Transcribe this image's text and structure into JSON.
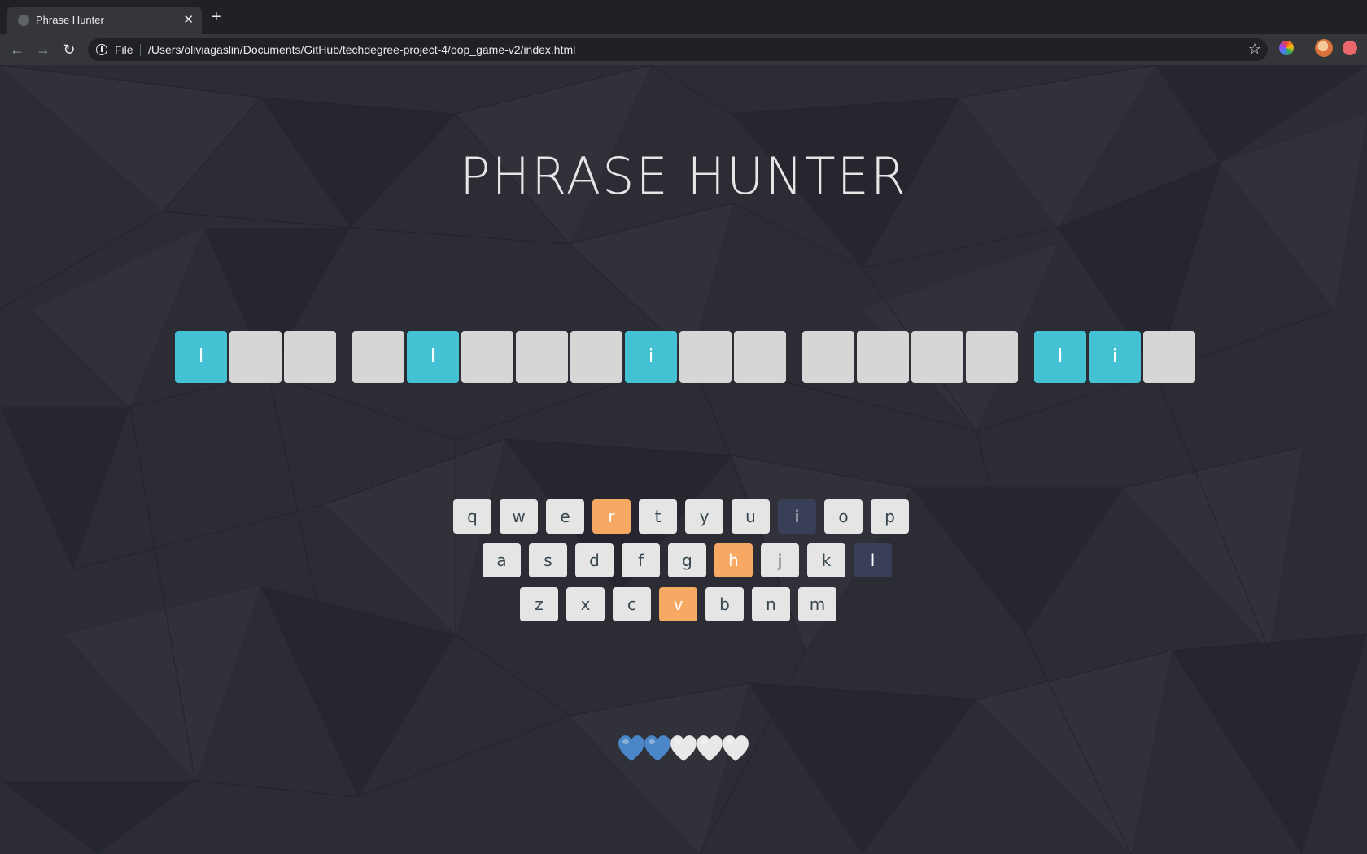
{
  "browser": {
    "tab_title": "Phrase Hunter",
    "tab_close": "✕",
    "new_tab": "+",
    "scheme": "File",
    "url": "/Users/oliviagaslin/Documents/GitHub/techdegree-project-4/oop_game-v2/index.html"
  },
  "game": {
    "title": "PHRASE HUNTER",
    "phrase": [
      {
        "letter": "l",
        "shown": true
      },
      {
        "letter": "",
        "shown": false
      },
      {
        "letter": "",
        "shown": false
      },
      {
        "letter": "",
        "shown": false
      },
      {
        "letter": "l",
        "shown": true
      },
      {
        "letter": "",
        "shown": false
      },
      {
        "letter": "",
        "shown": false
      },
      {
        "letter": "",
        "shown": false
      },
      {
        "letter": "i",
        "shown": true
      },
      {
        "letter": "",
        "shown": false
      },
      {
        "letter": "",
        "shown": false
      },
      {
        "letter": "",
        "shown": false
      },
      {
        "letter": "",
        "shown": false
      },
      {
        "letter": "",
        "shown": false
      },
      {
        "letter": "",
        "shown": false
      },
      {
        "letter": "l",
        "shown": true
      },
      {
        "letter": "i",
        "shown": true
      },
      {
        "letter": "",
        "shown": false
      }
    ],
    "keyboard": {
      "row1": [
        {
          "key": "q",
          "state": "default"
        },
        {
          "key": "w",
          "state": "default"
        },
        {
          "key": "e",
          "state": "default"
        },
        {
          "key": "r",
          "state": "wrong"
        },
        {
          "key": "t",
          "state": "default"
        },
        {
          "key": "y",
          "state": "default"
        },
        {
          "key": "u",
          "state": "default"
        },
        {
          "key": "i",
          "state": "chosen"
        },
        {
          "key": "o",
          "state": "default"
        },
        {
          "key": "p",
          "state": "default"
        }
      ],
      "row2": [
        {
          "key": "a",
          "state": "default"
        },
        {
          "key": "s",
          "state": "default"
        },
        {
          "key": "d",
          "state": "default"
        },
        {
          "key": "f",
          "state": "default"
        },
        {
          "key": "g",
          "state": "default"
        },
        {
          "key": "h",
          "state": "wrong"
        },
        {
          "key": "j",
          "state": "default"
        },
        {
          "key": "k",
          "state": "default"
        },
        {
          "key": "l",
          "state": "chosen"
        }
      ],
      "row3": [
        {
          "key": "z",
          "state": "default"
        },
        {
          "key": "x",
          "state": "default"
        },
        {
          "key": "c",
          "state": "default"
        },
        {
          "key": "v",
          "state": "wrong"
        },
        {
          "key": "b",
          "state": "default"
        },
        {
          "key": "n",
          "state": "default"
        },
        {
          "key": "m",
          "state": "default"
        }
      ]
    },
    "lives": {
      "total": 5,
      "remaining": 2
    },
    "colors": {
      "shown_letter": "#44c2d4",
      "hidden_letter": "#d6d6d6",
      "key_default": "#e5e5e5",
      "key_wrong": "#f7a964",
      "key_chosen": "#3a3f58",
      "live_heart": "#4a86c8",
      "lost_heart": "#e8e8e8"
    }
  }
}
